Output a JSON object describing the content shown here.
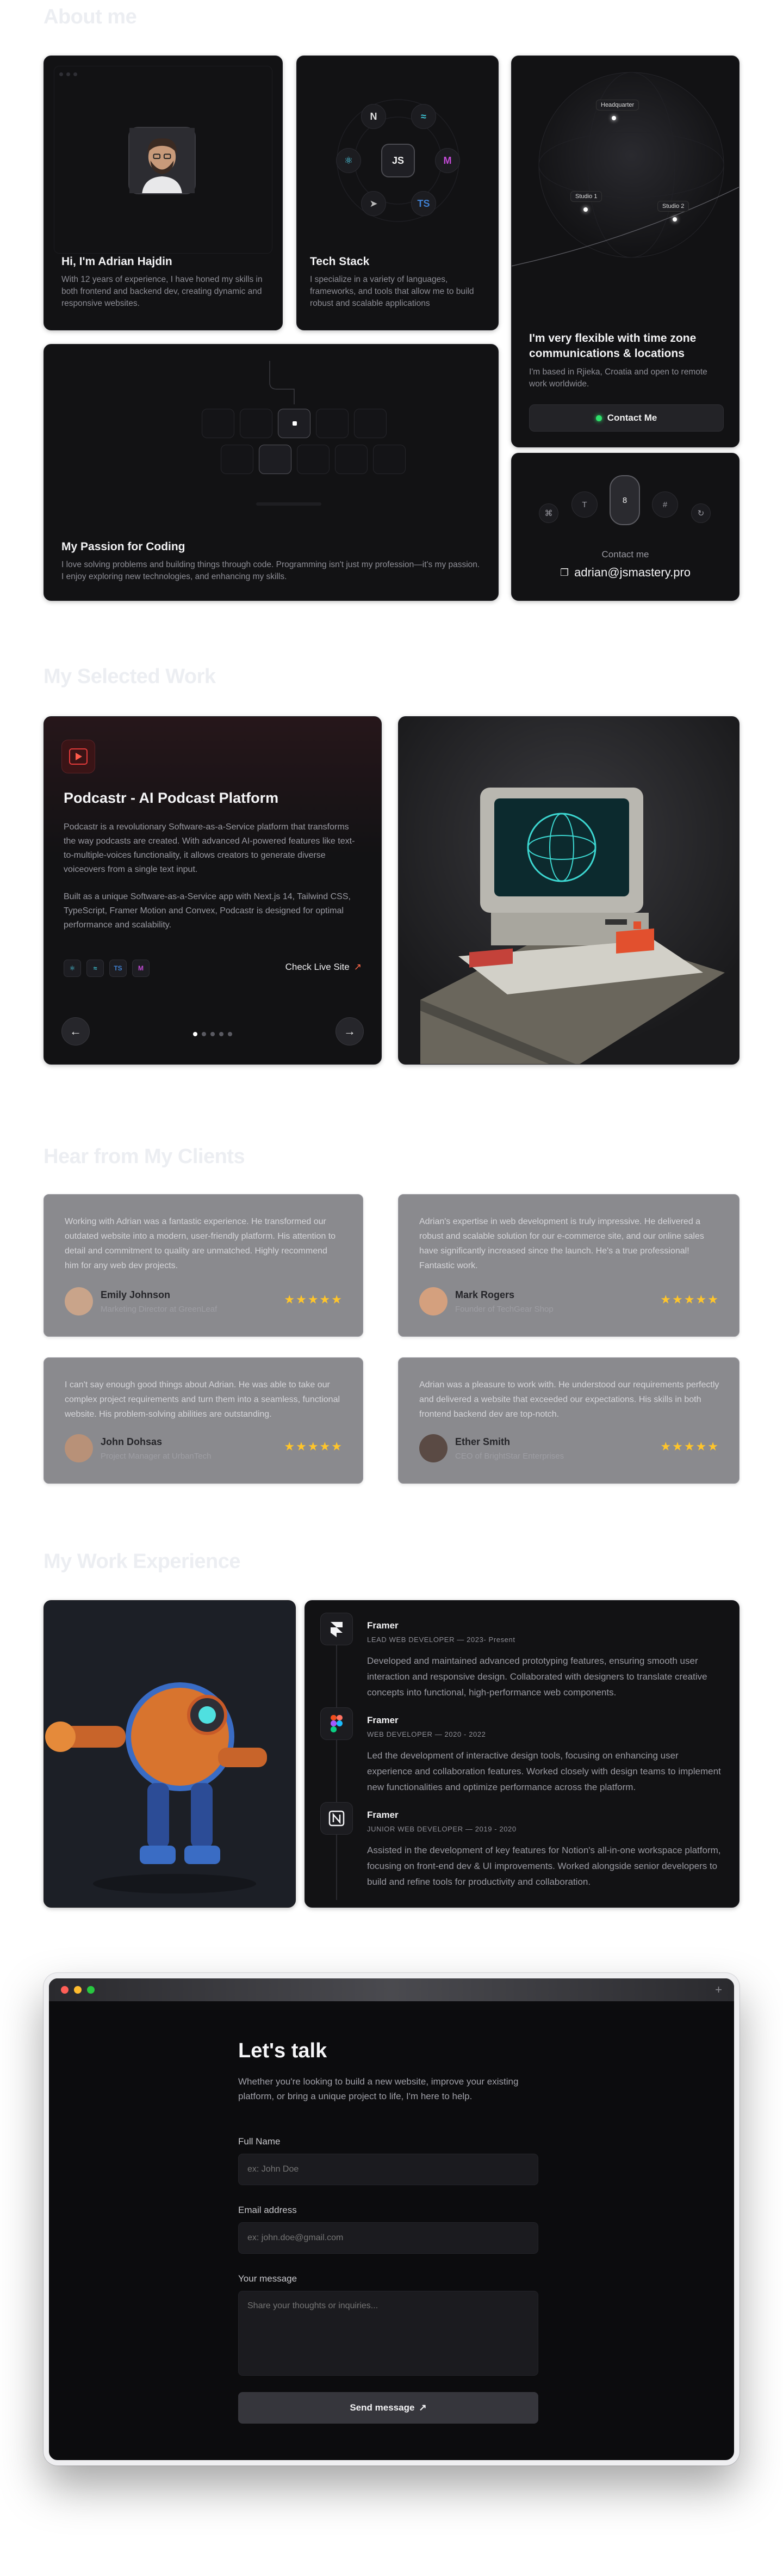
{
  "about": {
    "section_title": "About me",
    "profile": {
      "title": "Hi, I'm Adrian Hajdin",
      "text": "With 12 years of experience, I have honed my skills in both frontend and backend dev, creating dynamic and responsive websites."
    },
    "tech": {
      "title": "Tech Stack",
      "text": "I specialize in a variety of languages, frameworks, and tools that allow me to build robust and scalable applications",
      "center_label": "JS"
    },
    "location": {
      "title": "I'm very flexible with time zone communications & locations",
      "text": "I'm based in Rjieka, Croatia and open to remote work worldwide.",
      "pins": [
        "Headquarter",
        "Studio 1",
        "Studio 2"
      ],
      "button_label": "Contact Me"
    },
    "passion": {
      "title": "My Passion for Coding",
      "text": "I love solving problems and building things through code. Programming isn't just my profession—it's my passion. I enjoy exploring new technologies, and enhancing my skills."
    },
    "contact": {
      "label": "Contact me",
      "email": "adrian@jsmastery.pro",
      "keys": [
        "⌘",
        "T",
        "8",
        "#",
        "↻"
      ]
    }
  },
  "work": {
    "section_title": "My Selected Work",
    "project": {
      "title": "Podcastr - AI Podcast Platform",
      "para1": "Podcastr is a revolutionary Software-as-a-Service platform that transforms the way podcasts are created. With advanced AI-powered features like text-to-multiple-voices functionality, it allows creators to generate diverse voiceovers from a single text input.",
      "para2": "Built as a unique Software-as-a-Service app with Next.js 14, Tailwind CSS, TypeScript, Framer Motion and Convex, Podcastr is designed for optimal performance and scalability.",
      "live_label": "Check Live Site",
      "tech_icons": [
        "react-icon",
        "tailwind-icon",
        "typescript-icon",
        "motion-icon"
      ],
      "slide_count": 5,
      "active_slide": 1
    }
  },
  "testimonials": {
    "section_title": "Hear from My Clients",
    "items": [
      {
        "quote": "Working with Adrian was a fantastic experience. He transformed our outdated website into a modern, user-friendly platform. His attention to detail and commitment to quality are unmatched. Highly recommend him for any web dev projects.",
        "name": "Emily Johnson",
        "role": "Marketing Director at GreenLeaf",
        "stars": "★★★★★"
      },
      {
        "quote": "Adrian's expertise in web development is truly impressive. He delivered a robust and scalable solution for our e-commerce site, and our online sales have significantly increased since the launch. He's a true professional! Fantastic work.",
        "name": "Mark Rogers",
        "role": "Founder of TechGear Shop",
        "stars": "★★★★★"
      },
      {
        "quote": "I can't say enough good things about Adrian. He was able to take our complex project requirements and turn them into a seamless, functional website. His problem-solving abilities are outstanding.",
        "name": "John Dohsas",
        "role": "Project Manager at UrbanTech",
        "stars": "★★★★★"
      },
      {
        "quote": "Adrian was a pleasure to work with. He understood our requirements perfectly and delivered a website that exceeded our expectations. His skills in both frontend backend dev are top-notch.",
        "name": "Ether Smith",
        "role": "CEO of BrightStar Enterprises",
        "stars": "★★★★★"
      }
    ]
  },
  "experience": {
    "section_title": "My Work Experience",
    "items": [
      {
        "company": "Framer",
        "role": "LEAD WEB DEVELOPER — 2023- Present",
        "desc": "Developed and maintained advanced prototyping features, ensuring smooth user interaction and responsive design. Collaborated with designers to translate creative concepts into functional, high-performance web components.",
        "icon": "framer-icon"
      },
      {
        "company": "Framer",
        "role": "WEB DEVELOPER — 2020 - 2022",
        "desc": "Led the development of interactive design tools, focusing on enhancing user experience and collaboration features. Worked closely with design teams to implement new functionalities and optimize performance across the platform.",
        "icon": "figma-icon"
      },
      {
        "company": "Framer",
        "role": "JUNIOR WEB DEVELOPER — 2019 - 2020",
        "desc": "Assisted in the development of key features for Notion's all-in-one workspace platform, focusing on front-end dev & UI improvements. Worked alongside senior developers to build and refine tools for productivity and collaboration.",
        "icon": "notion-icon"
      }
    ]
  },
  "contact_form": {
    "title": "Let's talk",
    "subtitle": "Whether you're looking to build a new website, improve your existing platform, or bring a unique project to life, I'm here to help.",
    "name_label": "Full Name",
    "name_placeholder": "ex: John Doe",
    "email_label": "Email address",
    "email_placeholder": "ex: john.doe@gmail.com",
    "message_label": "Your message",
    "message_placeholder": "Share your thoughts or inquiries...",
    "submit_label": "Send message",
    "submit_arrow": "↗",
    "plus_icon": "+"
  },
  "colors": {
    "card_bg": "#121214",
    "testimonial_bg": "#8a8a8e",
    "star": "#ffc52a",
    "status_green": "#2ee06a",
    "accent_red": "#e23a3a"
  }
}
